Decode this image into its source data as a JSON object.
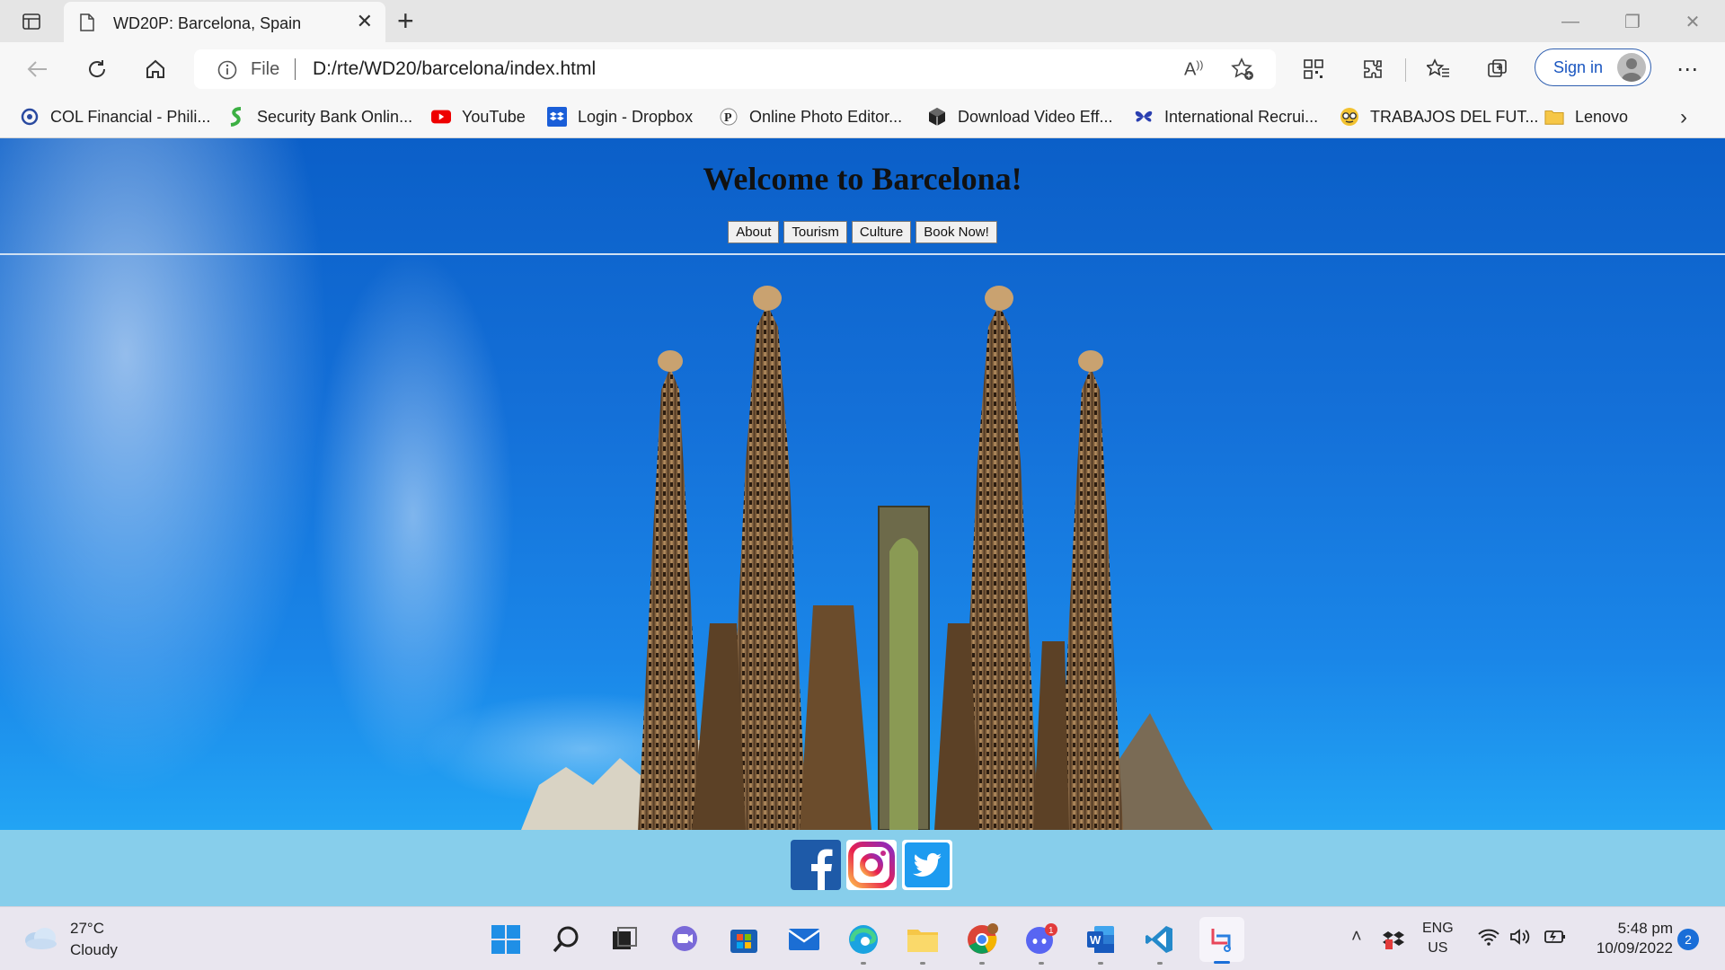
{
  "browser": {
    "tab_title": "WD20P: Barcelona, Spain",
    "new_tab_label": "+",
    "address_scheme": "File",
    "address_url": "D:/rte/WD20/barcelona/index.html",
    "sign_in_label": "Sign in",
    "bookmarks": [
      {
        "label": "COL Financial - Phili...",
        "icon": "col-financial-icon"
      },
      {
        "label": "Security Bank Onlin...",
        "icon": "security-bank-icon"
      },
      {
        "label": "YouTube",
        "icon": "youtube-icon"
      },
      {
        "label": "Login - Dropbox",
        "icon": "dropbox-icon"
      },
      {
        "label": "Online Photo Editor...",
        "icon": "photo-editor-icon"
      },
      {
        "label": "Download Video Eff...",
        "icon": "video-effects-icon"
      },
      {
        "label": "International Recrui...",
        "icon": "butterfly-icon"
      },
      {
        "label": "TRABAJOS DEL FUT...",
        "icon": "glasses-face-icon"
      },
      {
        "label": "Lenovo",
        "icon": "folder-icon"
      }
    ]
  },
  "page": {
    "title": "Welcome to Barcelona!",
    "nav": [
      "About",
      "Tourism",
      "Culture",
      "Book Now!"
    ],
    "socials": [
      "facebook-icon",
      "instagram-icon",
      "twitter-icon"
    ]
  },
  "taskbar": {
    "weather_temp": "27°C",
    "weather_desc": "Cloudy",
    "lang_line1": "ENG",
    "lang_line2": "US",
    "time": "5:48 pm",
    "date": "10/09/2022",
    "notification_count": "2",
    "discord_badge": "1"
  },
  "colors": {
    "footer": "#87ceeb",
    "sky": "#1470d8",
    "accent": "#1a56c0"
  }
}
